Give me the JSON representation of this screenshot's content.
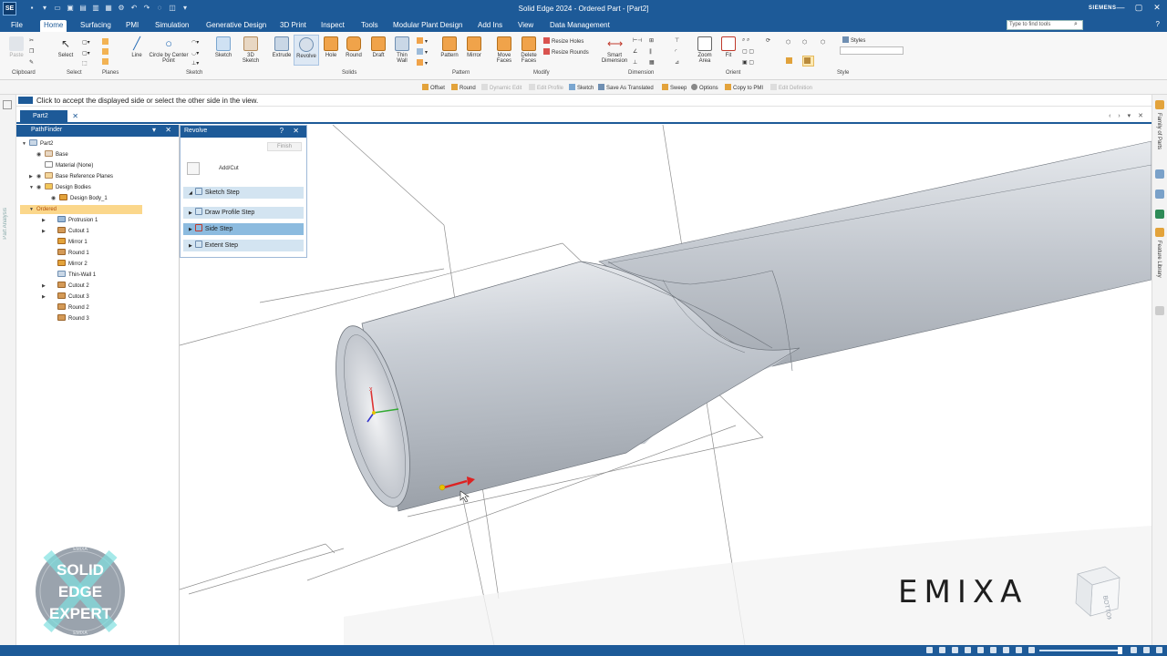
{
  "app": {
    "badge": "SE",
    "title": "Solid Edge 2024 - Ordered Part - [Part2]",
    "brand": "SIEMENS",
    "window_controls": [
      "—",
      "▢",
      "✕"
    ]
  },
  "menu": {
    "file": "File",
    "tabs": [
      "Home",
      "Surfacing",
      "PMI",
      "Simulation",
      "Generative Design",
      "3D Print",
      "Inspect",
      "Tools",
      "Modular Plant Design",
      "Add Ins",
      "View",
      "Data Management"
    ],
    "search_placeholder": "Type to find tools"
  },
  "ribbon": {
    "buttons": {
      "paste": "Paste",
      "select": "Select",
      "line": "Line",
      "circle": "Circle by Center Point",
      "sketch": "Sketch",
      "sketch3d": "3D Sketch",
      "extrude": "Extrude",
      "revolve": "Revolve",
      "hole": "Hole",
      "round": "Round",
      "draft": "Draft",
      "thinwall": "Thin Wall",
      "pattern": "Pattern",
      "mirror": "Mirror",
      "move_faces": "Move Faces",
      "delete_faces": "Delete Faces",
      "resize_holes": "Resize Holes",
      "resize_rounds": "Resize Rounds",
      "smart_dimension": "Smart Dimension",
      "zoom_area": "Zoom Area",
      "fit": "Fit",
      "styles": "Styles"
    },
    "groups": [
      "Clipboard",
      "Select",
      "Planes",
      "Sketch",
      "Solids",
      "Pattern",
      "Modify",
      "Dimension",
      "Orient",
      "Style"
    ]
  },
  "command_bar": [
    {
      "label": "Offset",
      "enabled": true
    },
    {
      "label": "Round",
      "enabled": true
    },
    {
      "label": "Dynamic Edit",
      "enabled": false
    },
    {
      "label": "Edit Profile",
      "enabled": false
    },
    {
      "label": "Sketch",
      "enabled": true
    },
    {
      "label": "Save As Translated",
      "enabled": true
    },
    {
      "label": "Sweep",
      "enabled": true
    },
    {
      "label": "Options",
      "enabled": true
    },
    {
      "label": "Copy to PMI",
      "enabled": true
    },
    {
      "label": "Edit Definition",
      "enabled": false
    }
  ],
  "prompt": "Click to accept the displayed side or select the other side in the view.",
  "left_strip_label": "Part Analysis",
  "doc_tab": "Part2",
  "pathfinder": {
    "title": "PathFinder",
    "tree": [
      {
        "label": "Part2",
        "icon": "part-icon"
      },
      {
        "label": "Base",
        "icon": "base-icon"
      },
      {
        "label": "Material (None)",
        "icon": "material-icon"
      },
      {
        "label": "Base Reference Planes",
        "icon": "planes-icon"
      },
      {
        "label": "Design Bodies",
        "icon": "folder-icon"
      },
      {
        "label": "Design Body_1",
        "icon": "body-icon"
      },
      {
        "label": "Ordered",
        "icon": "ordered-icon"
      },
      {
        "label": "Protrusion 1",
        "icon": "protrusion-icon"
      },
      {
        "label": "Cutout 1",
        "icon": "cutout-icon"
      },
      {
        "label": "Mirror 1",
        "icon": "mirror-icon"
      },
      {
        "label": "Round 1",
        "icon": "round-icon"
      },
      {
        "label": "Mirror 2",
        "icon": "mirror-icon"
      },
      {
        "label": "Thin-Wall 1",
        "icon": "thinwall-icon"
      },
      {
        "label": "Cutout 2",
        "icon": "cutout-icon"
      },
      {
        "label": "Cutout 3",
        "icon": "cutout-icon"
      },
      {
        "label": "Round 2",
        "icon": "round-icon"
      },
      {
        "label": "Round 3",
        "icon": "round-icon"
      }
    ]
  },
  "revolve_panel": {
    "title": "Revolve",
    "finish": "Finish",
    "add_cut": "Add/Cut",
    "steps": [
      {
        "label": "Sketch Step",
        "state": "expanded"
      },
      {
        "label": "Draw Profile Step",
        "state": "collapsed"
      },
      {
        "label": "Side Step",
        "state": "selected"
      },
      {
        "label": "Extent Step",
        "state": "collapsed"
      }
    ]
  },
  "right_strip": {
    "tabs": [
      "Family of Parts",
      "Feature Library"
    ]
  },
  "watermarks": {
    "badge_line1": "SOLID",
    "badge_line2": "EDGE",
    "badge_line3": "EXPERT",
    "badge_ring": "EMIXA",
    "logo": "EMIXA",
    "viewcube_face": "BOTTOM"
  },
  "colors": {
    "brand_blue": "#1d5a98",
    "step_bg": "#d3e4f1",
    "step_selected": "#8cbbdf",
    "ordered_highlight": "#fbd78b"
  }
}
